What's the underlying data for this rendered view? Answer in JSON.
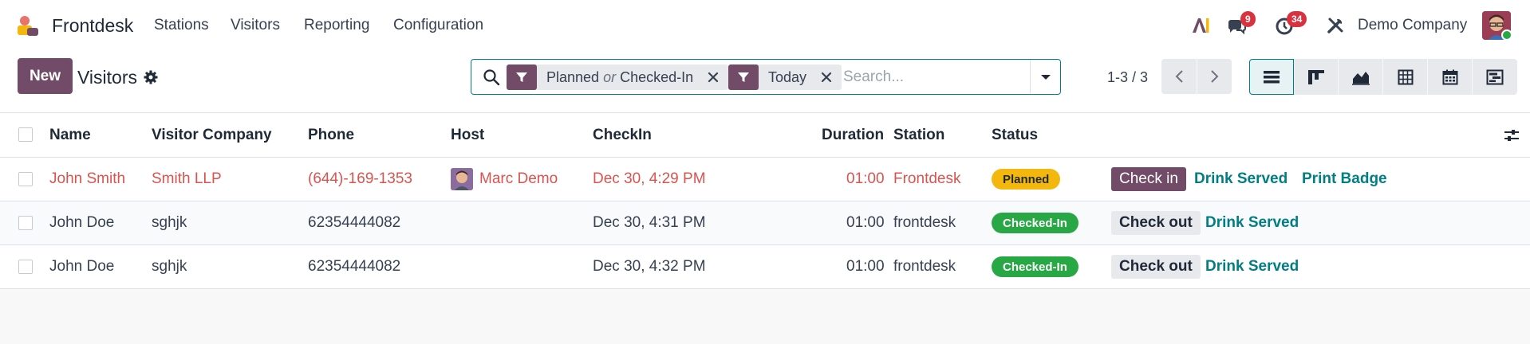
{
  "app": {
    "name": "Frontdesk"
  },
  "menu": [
    "Stations",
    "Visitors",
    "Reporting",
    "Configuration"
  ],
  "systray": {
    "messages_count": "9",
    "activities_count": "34",
    "company": "Demo Company"
  },
  "control": {
    "new_label": "New",
    "title": "Visitors",
    "facets": [
      {
        "part1": "Planned",
        "or": "or",
        "part2": "Checked-In"
      },
      {
        "label": "Today"
      }
    ],
    "search_placeholder": "Search...",
    "pager": "1-3 / 3"
  },
  "views": [
    "list-icon",
    "kanban-icon",
    "graph-icon",
    "pivot-icon",
    "calendar-icon",
    "gantt-icon"
  ],
  "table": {
    "headers": {
      "name": "Name",
      "company": "Visitor Company",
      "phone": "Phone",
      "host": "Host",
      "checkin": "CheckIn",
      "duration": "Duration",
      "station": "Station",
      "status": "Status"
    },
    "rows": [
      {
        "name": "John Smith",
        "company": "Smith LLP",
        "phone": "(644)-169-1353",
        "host": "Marc Demo",
        "checkin": "Dec 30, 4:29 PM",
        "duration": "01:00",
        "station": "Frontdesk",
        "status": "Planned",
        "action": "Check in",
        "drink": "Drink Served",
        "badge": "Print Badge"
      },
      {
        "name": "John Doe",
        "company": "sghjk",
        "phone": "62354444082",
        "host": "",
        "checkin": "Dec 30, 4:31 PM",
        "duration": "01:00",
        "station": "frontdesk",
        "status": "Checked-In",
        "action": "Check out",
        "drink": "Drink Served"
      },
      {
        "name": "John Doe",
        "company": "sghjk",
        "phone": "62354444082",
        "host": "",
        "checkin": "Dec 30, 4:32 PM",
        "duration": "01:00",
        "station": "frontdesk",
        "status": "Checked-In",
        "action": "Check out",
        "drink": "Drink Served"
      }
    ]
  },
  "colors": {
    "brand": "#714b67",
    "teal": "#017e84",
    "planned": "#f3b70d",
    "checked_in": "#28a745",
    "overdue_text": "#d9534f"
  }
}
